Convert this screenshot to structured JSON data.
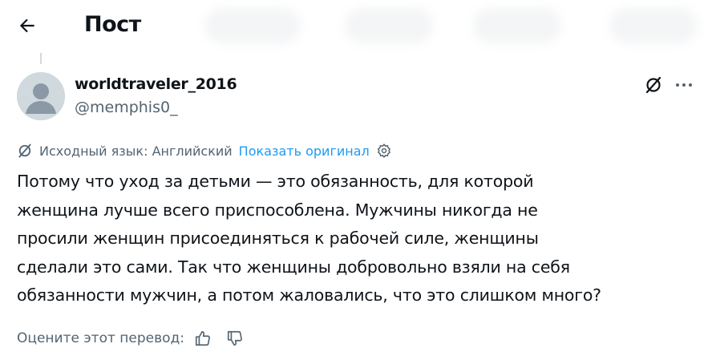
{
  "header": {
    "title": "Пост",
    "back_icon": "arrow-left-icon"
  },
  "post": {
    "author": {
      "display_name": "worldtraveler_2016",
      "handle": "@memphis0_",
      "avatar": "default-avatar-icon"
    },
    "translation": {
      "source_language_label": "Исходный язык: Английский",
      "show_original_label": "Показать оригинал",
      "icon": "translate-icon",
      "settings_icon": "gear-icon"
    },
    "text": "Потому что уход за детьми — это обязанность, для которой\nженщина лучше всего приспособлена. Мужчины никогда не\nпросили женщин присоединяться к рабочей силе, женщины\nсделали это сами. Так что женщины добровольно взяли на себя\nобязанности мужчин, а потом жаловались, что это слишком много?",
    "rate_translation_label": "Оцените этот перевод:",
    "rate_icons": [
      "thumbs-up-icon",
      "thumbs-down-icon"
    ]
  },
  "colors": {
    "text": "#0f1419",
    "secondary": "#536471",
    "link": "#1d9bf0",
    "thread_line": "#cfd9de"
  }
}
